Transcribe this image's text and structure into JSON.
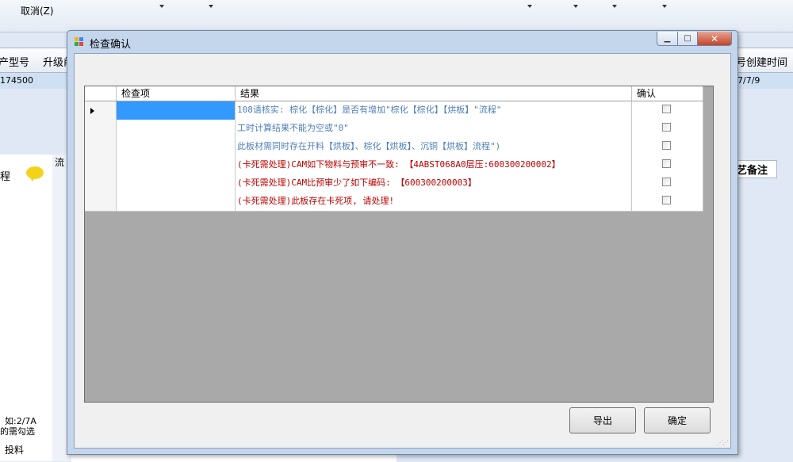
{
  "background": {
    "toolbar": {
      "cancel_label": "取消(Z)"
    },
    "grid_headers": [
      "产型号",
      "升级前",
      "号创建时间"
    ],
    "selected_row": {
      "left_value": "174500",
      "right_value": "7/7/9"
    },
    "left_panel": {
      "label": "程",
      "flow_label": "流",
      "note_line1": "如:2/7A",
      "note_line2": "的需勾选",
      "bottom_tab": "投料"
    },
    "right_tab": "艺备注"
  },
  "dialog": {
    "title": "检查确认",
    "title_buttons": {
      "minimize": "▁",
      "maximize": "□",
      "close": "✕"
    },
    "grid": {
      "columns": [
        "检查项",
        "结果",
        "确认"
      ],
      "rows": [
        {
          "item": "",
          "result": "108请核实: 棕化【棕化】是否有增加\"棕化【棕化】【烘板】\"流程\"",
          "confirmed": false,
          "color": "#4f7fb8",
          "current": true
        },
        {
          "item": "",
          "result": "工时计算结果不能为空或\"0\"",
          "confirmed": false,
          "color": "#4f7fb8",
          "current": false
        },
        {
          "item": "",
          "result": "此板材需同时存在开料【烘板】、棕化【烘板】、沉铜【烘板】流程\")",
          "confirmed": false,
          "color": "#4f7fb8",
          "current": false
        },
        {
          "item": "",
          "result": "(卡死需处理)CAM如下物料与预审不一致: 【4ABST068A0层压:600300200002】",
          "confirmed": false,
          "color": "#c00000",
          "current": false
        },
        {
          "item": "",
          "result": "(卡死需处理)CAM比预审少了如下编码: 【600300200003】",
          "confirmed": false,
          "color": "#c00000",
          "current": false
        },
        {
          "item": "",
          "result": "(卡死需处理)此板存在卡死项, 请处理!",
          "confirmed": false,
          "color": "#c00000",
          "current": false
        }
      ]
    },
    "buttons": {
      "export": "导出",
      "confirm": "确定"
    }
  }
}
